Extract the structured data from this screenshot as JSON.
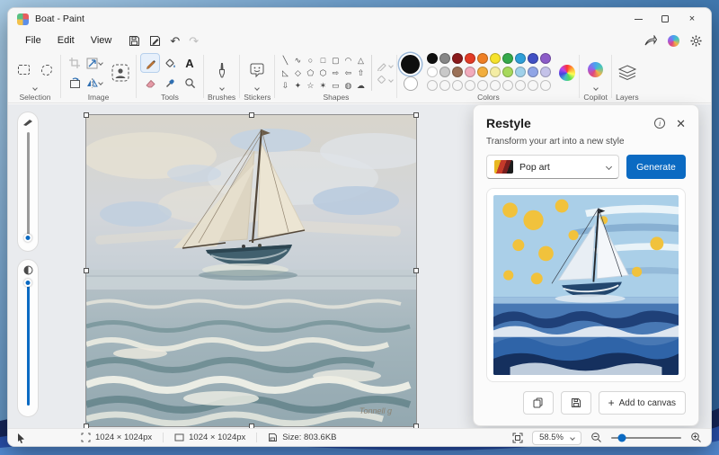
{
  "window": {
    "title": "Boat - Paint"
  },
  "menu": {
    "items": [
      "File",
      "Edit",
      "View"
    ]
  },
  "ribbon": {
    "groups": {
      "selection": "Selection",
      "image": "Image",
      "tools": "Tools",
      "brushes": "Brushes",
      "stickers": "Stickers",
      "shapes": "Shapes",
      "colors": "Colors",
      "copilot": "Copilot",
      "layers": "Layers"
    },
    "shape_glyphs": [
      "╲",
      "∿",
      "○",
      "□",
      "▢",
      "◠",
      "△",
      "◺",
      "◇",
      "⬠",
      "⬡",
      "⇨",
      "⇦",
      "⇧",
      "⇩",
      "✦",
      "☆",
      "✶",
      "▭",
      "◍",
      "☁"
    ],
    "palette_row1": [
      "#0f0f0f",
      "#868686",
      "#8a1a1c",
      "#e23b26",
      "#ee7f25",
      "#f6e22b",
      "#35a94b",
      "#2f9fd8",
      "#4150c4",
      "#8c5cc8"
    ],
    "palette_row2": [
      "#ffffff",
      "#c9c9c9",
      "#9b7158",
      "#f2abbc",
      "#f2ae3e",
      "#f4eda4",
      "#a7d95c",
      "#a0d1ea",
      "#90a5e6",
      "#c4c2e9"
    ],
    "palette_row3": [
      "",
      "",
      "",
      "",
      "",
      "",
      "",
      "",
      "",
      ""
    ],
    "selected_color": "#0f0f0f",
    "secondary_color": "#ffffff"
  },
  "restyle": {
    "title": "Restyle",
    "subtitle": "Transform your art into a new style",
    "style_selected": "Pop art",
    "generate_label": "Generate",
    "plus_glyph": "+",
    "add_to_canvas_label": "Add to canvas"
  },
  "canvas": {
    "signature": "Tonnell g"
  },
  "statusbar": {
    "selection_size": "1024 × 1024px",
    "canvas_size": "1024 × 1024px",
    "file_size": "Size: 803.6KB",
    "zoom_level": "58.5%"
  },
  "colors": {
    "accent": "#0b6ac2"
  }
}
